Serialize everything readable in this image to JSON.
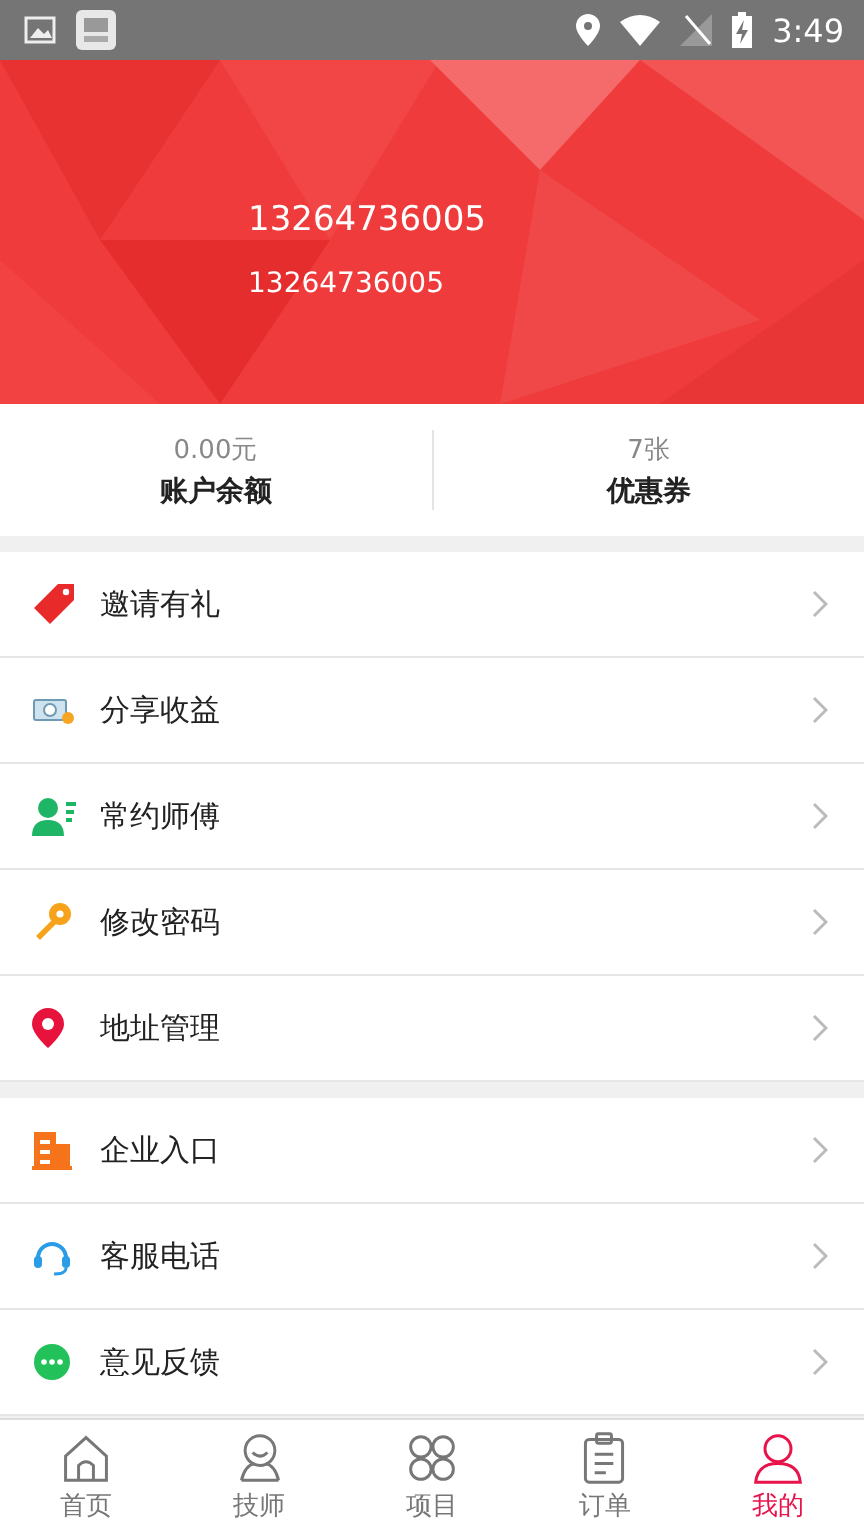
{
  "status_bar": {
    "time": "3:49"
  },
  "profile": {
    "name": "13264736005",
    "phone": "13264736005"
  },
  "stats": [
    {
      "value": "0.00元",
      "label": "账户余额"
    },
    {
      "value": "7张",
      "label": "优惠券"
    }
  ],
  "menu_groups": [
    [
      {
        "kind": "tag",
        "label": "邀请有礼"
      },
      {
        "kind": "money",
        "label": "分享收益"
      },
      {
        "kind": "person",
        "label": "常约师傅"
      },
      {
        "kind": "key",
        "label": "修改密码"
      },
      {
        "kind": "pin",
        "label": "地址管理"
      }
    ],
    [
      {
        "kind": "building",
        "label": "企业入口"
      },
      {
        "kind": "headset",
        "label": "客服电话"
      },
      {
        "kind": "chat",
        "label": "意见反馈"
      }
    ]
  ],
  "tabs": [
    {
      "kind": "home",
      "label": "首页",
      "selected": false
    },
    {
      "kind": "tech",
      "label": "技师",
      "selected": false
    },
    {
      "kind": "grid",
      "label": "项目",
      "selected": false
    },
    {
      "kind": "order",
      "label": "订单",
      "selected": false
    },
    {
      "kind": "me",
      "label": "我的",
      "selected": true
    }
  ]
}
